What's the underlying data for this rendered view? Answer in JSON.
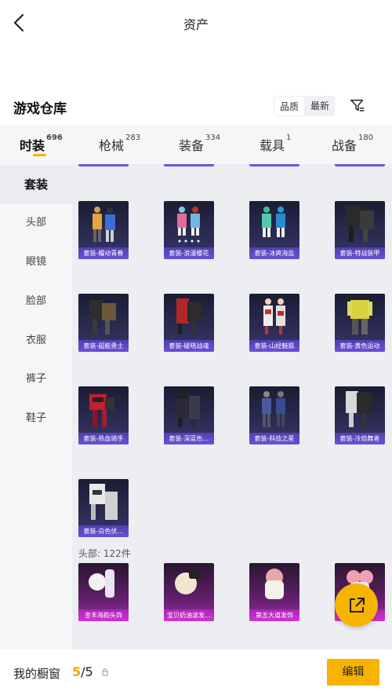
{
  "header": {
    "title": "资产"
  },
  "warehouse": {
    "title": "游戏仓库",
    "sort_options": [
      "品质",
      "最新"
    ]
  },
  "tabs": [
    {
      "label": "时装",
      "count": "696",
      "active": true
    },
    {
      "label": "枪械",
      "count": "283"
    },
    {
      "label": "装备",
      "count": "334"
    },
    {
      "label": "载具",
      "count": "1"
    },
    {
      "label": "战备",
      "count": "180"
    }
  ],
  "sidebar": {
    "items": [
      {
        "label": "套装",
        "active": true
      },
      {
        "label": "头部"
      },
      {
        "label": "眼镜"
      },
      {
        "label": "脸部"
      },
      {
        "label": "衣服"
      },
      {
        "label": "裤子"
      },
      {
        "label": "鞋子"
      }
    ]
  },
  "suits": [
    {
      "label": "套装-耀动青春"
    },
    {
      "label": "套装-浪漫樱花"
    },
    {
      "label": "套装-冰爽海盐"
    },
    {
      "label": "套装-特战装甲"
    },
    {
      "label": "套装-超能勇士"
    },
    {
      "label": "套装-破晓战魂"
    },
    {
      "label": "套装-山经魅狐"
    },
    {
      "label": "套装-黄色运动"
    },
    {
      "label": "套装-热血骑手"
    },
    {
      "label": "套装-深蓝色…"
    },
    {
      "label": "套装-科技之星"
    },
    {
      "label": "套装-冷焰舞者"
    },
    {
      "label": "套装-白色伏…"
    }
  ],
  "head_section": {
    "label": "头部: 122件",
    "items": [
      {
        "label": "金丰海韵头饰"
      },
      {
        "label": "宝贝奶油波发…"
      },
      {
        "label": "第五大道发饰"
      },
      {
        "label": "…饰"
      }
    ]
  },
  "bottom": {
    "shelf_label": "我的橱窗",
    "shelf_current": "5",
    "shelf_total": "/5",
    "edit_label": "编辑"
  },
  "colors": {
    "accent": "#f6b400",
    "suit_bar": "#7b6cff",
    "head_bar": "#e05ae8"
  }
}
